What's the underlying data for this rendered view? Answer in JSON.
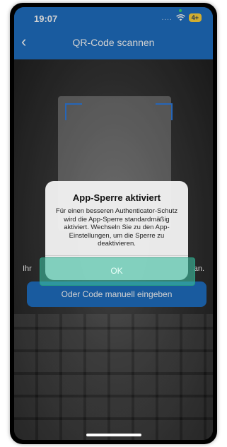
{
  "status_bar": {
    "time": "19:07",
    "signal_dots": "....",
    "wifi_icon": "wifi-icon",
    "battery": "4+"
  },
  "header": {
    "title": "QR-Code scannen",
    "back_icon": "chevron-left-icon",
    "back_glyph": "‹"
  },
  "scanner": {
    "instruction_left": "Ihr",
    "instruction_right": "an."
  },
  "manual_button": {
    "label": "Oder Code manuell eingeben"
  },
  "dialog": {
    "title": "App-Sperre aktiviert",
    "message": "Für einen besseren Authenticator-Schutz wird die App-Sperre standardmäßig aktiviert. Wechseln Sie zu den App-Einstellungen, um die Sperre zu deaktivieren.",
    "ok_label": "OK"
  },
  "colors": {
    "accent": "#1f6fc2",
    "highlight": "#3cbea0"
  }
}
